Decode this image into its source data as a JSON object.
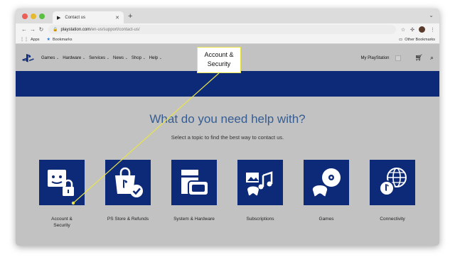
{
  "browser": {
    "tab_title": "Contact us",
    "new_tab": "+",
    "url_domain": "playstation.com",
    "url_path": "/en-us/support/contact-us/",
    "bookmarks": [
      {
        "label": "Apps",
        "icon": "apps-grid-icon"
      },
      {
        "label": "Bookmarks",
        "icon": "star-icon"
      }
    ],
    "other_bookmarks": "Other Bookmarks"
  },
  "site_nav": {
    "menu": [
      {
        "label": "Games"
      },
      {
        "label": "Hardware"
      },
      {
        "label": "Services"
      },
      {
        "label": "News"
      },
      {
        "label": "Shop"
      },
      {
        "label": "Help"
      }
    ],
    "my_playstation": "My PlayStation"
  },
  "main": {
    "headline": "What do you need help with?",
    "subline": "Select a topic to find the best way to contact us.",
    "topics": [
      {
        "label": "Account &\nSecurity",
        "icon": "account-security-icon"
      },
      {
        "label": "PS Store & Refunds",
        "icon": "ps-store-icon"
      },
      {
        "label": "System & Hardware",
        "icon": "system-hardware-icon"
      },
      {
        "label": "Subscriptions",
        "icon": "subscriptions-icon"
      },
      {
        "label": "Games",
        "icon": "games-disc-icon"
      },
      {
        "label": "Connectivity",
        "icon": "connectivity-globe-icon"
      }
    ]
  },
  "callout": {
    "line1": "Account &",
    "line2": "Security",
    "color": "#e9e447"
  },
  "colors": {
    "brand_blue": "#0d2a78",
    "headline_blue": "#355d92",
    "page_bg": "#c2c2c2"
  }
}
